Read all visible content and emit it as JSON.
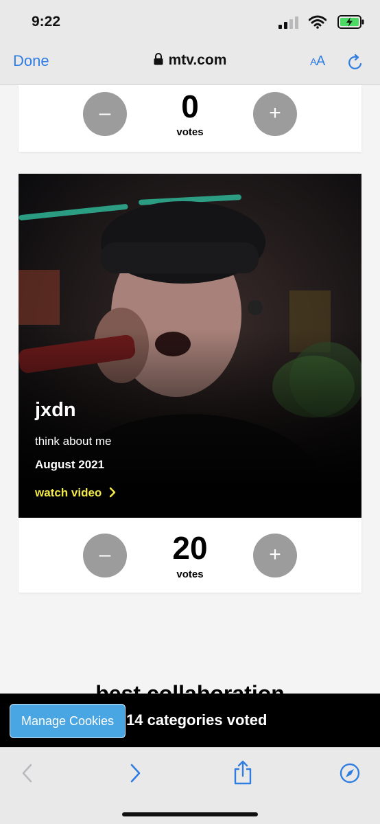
{
  "status_bar": {
    "time": "9:22",
    "icons": [
      "cellular-signal-icon",
      "wifi-icon",
      "battery-charging-icon"
    ],
    "battery_color": "#4cd964"
  },
  "browser": {
    "done_label": "Done",
    "url": "mtv.com",
    "text_size_label_small": "A",
    "text_size_label_large": "A",
    "accent_color": "#2f7de1"
  },
  "vote_cards": [
    {
      "count": "0",
      "label": "votes",
      "minus": "–",
      "plus": "+"
    },
    {
      "count": "20",
      "label": "votes",
      "minus": "–",
      "plus": "+"
    }
  ],
  "video_card": {
    "artist": "jxdn",
    "song": "think about me",
    "date": "August 2021",
    "watch_label": "watch video",
    "link_color": "#f4e94a"
  },
  "next_section": {
    "title": "best collaboration"
  },
  "cookie_bar": {
    "manage_label": "Manage Cookies",
    "voted_text": "14 categories voted",
    "button_color": "#4aa6e2"
  },
  "toolbar": {
    "icons": [
      "back-icon",
      "forward-icon",
      "share-icon",
      "compass-icon"
    ]
  }
}
